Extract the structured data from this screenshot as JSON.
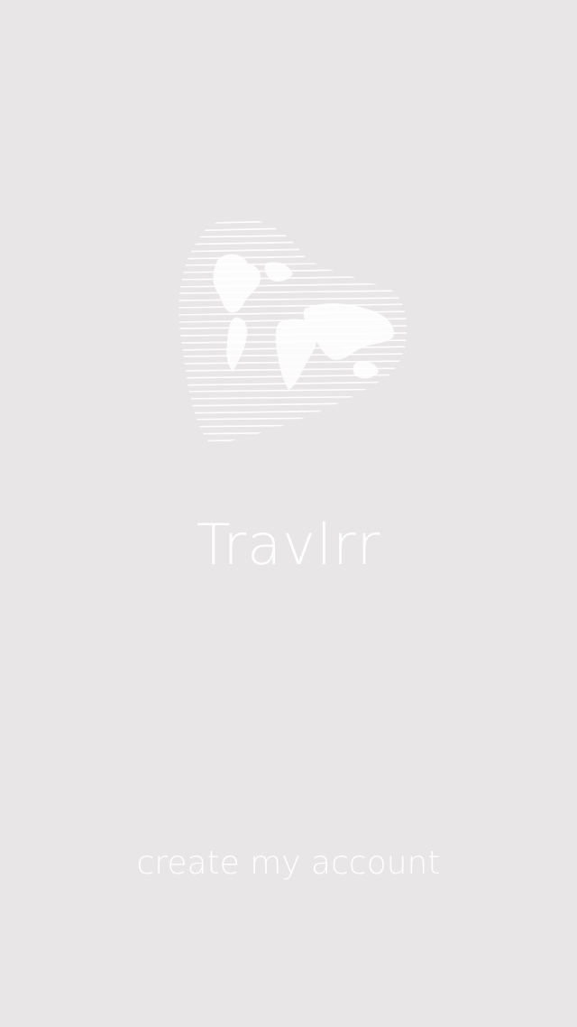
{
  "app": {
    "title": "Travlrr",
    "logo_icon": "heart-world-map-icon"
  },
  "actions": {
    "create_account_label": "create my account"
  },
  "colors": {
    "background": "#e8e6e7",
    "foreground": "#ffffff"
  }
}
